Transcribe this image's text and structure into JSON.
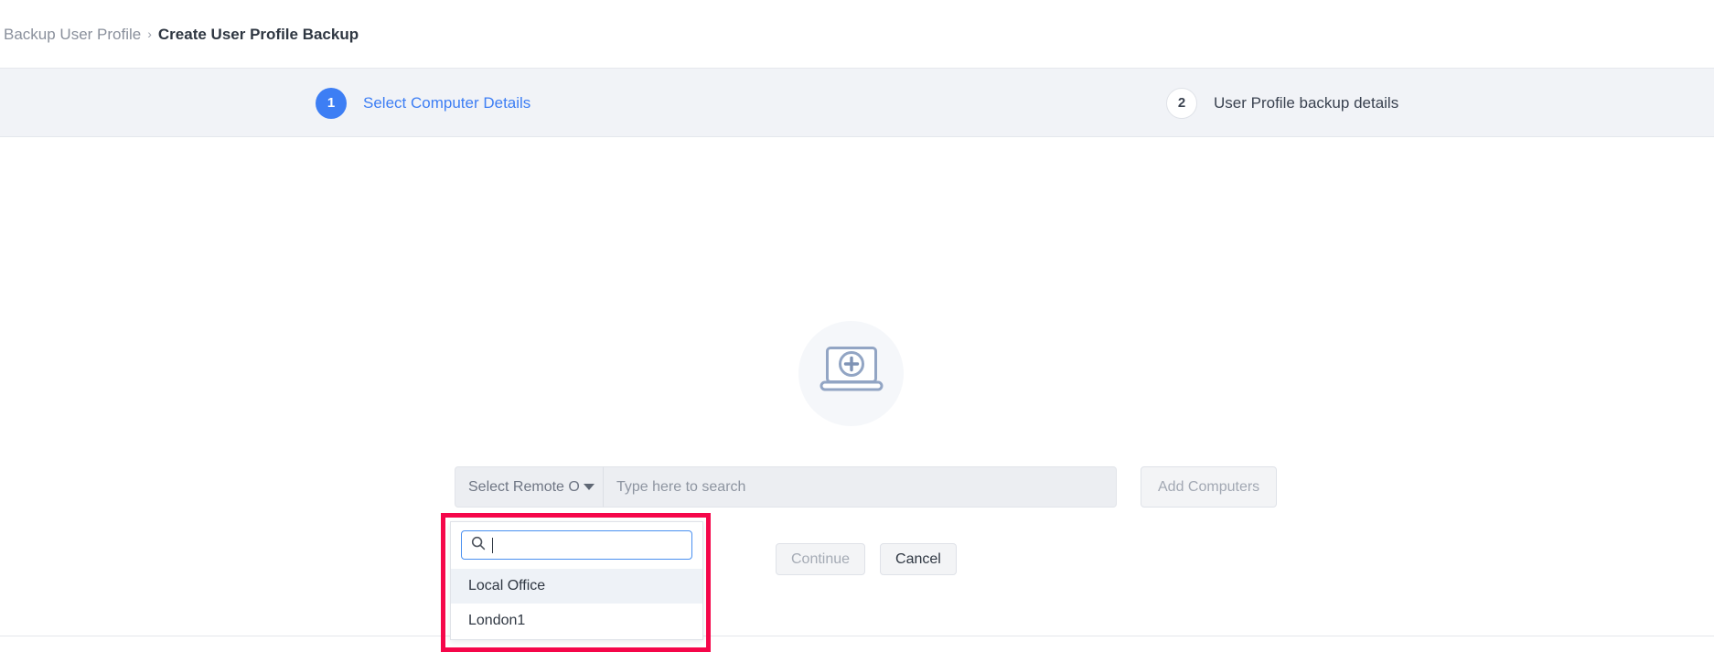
{
  "breadcrumb": {
    "parent": "Backup User Profile",
    "separator": "›",
    "current": "Create User Profile Backup"
  },
  "stepper": {
    "steps": [
      {
        "number": "1",
        "label": "Select Computer Details",
        "state": "active"
      },
      {
        "number": "2",
        "label": "User Profile backup details",
        "state": "inactive"
      }
    ]
  },
  "illustration": {
    "icon": "laptop-add-icon"
  },
  "search_row": {
    "select": {
      "value": "Select Remote O...",
      "caret_icon": "chevron-down-icon"
    },
    "search": {
      "value": "",
      "placeholder": "Type here to search"
    },
    "add_computers_label": "Add Computers"
  },
  "dropdown": {
    "search": {
      "value": "",
      "placeholder": "",
      "icon": "search-icon"
    },
    "options": [
      {
        "label": "Local Office",
        "highlighted": true
      },
      {
        "label": "London1",
        "highlighted": false
      }
    ]
  },
  "actions": {
    "continue_label": "Continue",
    "cancel_label": "Cancel"
  },
  "colors": {
    "accent_blue": "#3d7ef4",
    "annotation_red": "#f5064a",
    "band_background": "#f1f3f7",
    "icon_slate": "#92a5c4"
  }
}
